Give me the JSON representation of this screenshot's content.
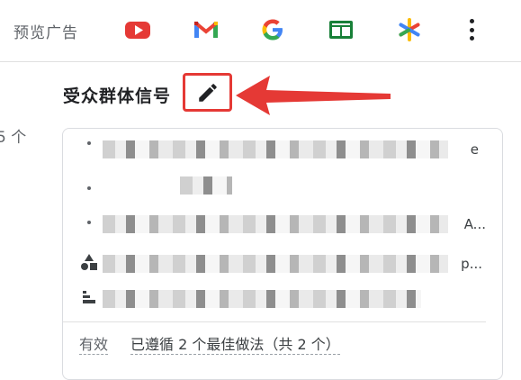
{
  "topbar": {
    "preview_label": "预览广告",
    "apps": [
      {
        "icon": "youtube-icon",
        "color": "#e53935"
      },
      {
        "icon": "gmail-icon",
        "color": "#ea4335"
      },
      {
        "icon": "google-icon",
        "color": "#4285f4"
      },
      {
        "icon": "sheets-layout-icon",
        "color": "#188038"
      },
      {
        "icon": "asterisk-star-icon",
        "color": "#fbbc04"
      }
    ],
    "more_icon": "more-vert-icon"
  },
  "left_count": "5 个",
  "section": {
    "title": "受众群体信号",
    "edit_icon": "pencil-icon",
    "highlight_color": "#e53935"
  },
  "card": {
    "rows": [
      {
        "icon": "dot-icon",
        "tail": "e"
      },
      {
        "icon": "dot-icon",
        "tail": ""
      },
      {
        "icon": "dot-icon",
        "tail": "A..."
      },
      {
        "icon": "shapes-icon",
        "tail": "p..."
      },
      {
        "icon": "bars-icon",
        "tail": ""
      }
    ],
    "row_fragments": [
      "ıf|)",
      "mon、"
    ],
    "status_label": "有效",
    "status_text": "已遵循 2 个最佳做法（共 2 个）"
  }
}
